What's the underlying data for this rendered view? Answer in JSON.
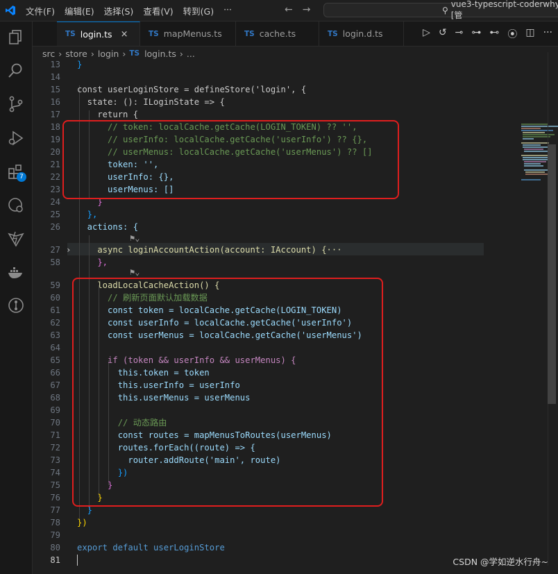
{
  "menu": [
    "文件(F)",
    "编辑(E)",
    "选择(S)",
    "查看(V)",
    "转到(G)",
    "···"
  ],
  "search_text": "vue3-typescript-coderwhy [管",
  "tabs": [
    {
      "icon": "TS",
      "label": "login.ts",
      "active": true,
      "close": "×"
    },
    {
      "icon": "TS",
      "label": "mapMenus.ts",
      "active": false
    },
    {
      "icon": "TS",
      "label": "cache.ts",
      "active": false
    },
    {
      "icon": "TS",
      "label": "login.d.ts",
      "active": false
    }
  ],
  "breadcrumb": {
    "parts": [
      "src",
      "store",
      "login"
    ],
    "file_icon": "TS",
    "file": "login.ts",
    "more": "..."
  },
  "badge_count": "7",
  "watermark": "CSDN @学如逆水行舟~",
  "code_lines": [
    {
      "n": "13",
      "text": "}"
    },
    {
      "n": "14",
      "text": ""
    },
    {
      "n": "15",
      "text": "const userLoginStore = defineStore('login', {"
    },
    {
      "n": "16",
      "text": "  state: (): ILoginState => {"
    },
    {
      "n": "17",
      "text": "    return {"
    },
    {
      "n": "18",
      "text": "      // token: localCache.getCache(LOGIN_TOKEN) ?? '',"
    },
    {
      "n": "19",
      "text": "      // userInfo: localCache.getCache('userInfo') ?? {},"
    },
    {
      "n": "20",
      "text": "      // userMenus: localCache.getCache('userMenus') ?? []"
    },
    {
      "n": "21",
      "text": "      token: '',"
    },
    {
      "n": "22",
      "text": "      userInfo: {},"
    },
    {
      "n": "23",
      "text": "      userMenus: []"
    },
    {
      "n": "24",
      "text": "    }"
    },
    {
      "n": "25",
      "text": "  },"
    },
    {
      "n": "26",
      "text": "  actions: {"
    },
    {
      "n": "27",
      "text": "    async loginAccountAction(account: IAccount) {···"
    },
    {
      "n": "58",
      "text": "    },"
    },
    {
      "n": "59",
      "text": "    loadLocalCacheAction() {"
    },
    {
      "n": "60",
      "text": "      // 刷新页面默认加载数据"
    },
    {
      "n": "61",
      "text": "      const token = localCache.getCache(LOGIN_TOKEN)"
    },
    {
      "n": "62",
      "text": "      const userInfo = localCache.getCache('userInfo')"
    },
    {
      "n": "63",
      "text": "      const userMenus = localCache.getCache('userMenus')"
    },
    {
      "n": "64",
      "text": ""
    },
    {
      "n": "65",
      "text": "      if (token && userInfo && userMenus) {"
    },
    {
      "n": "66",
      "text": "        this.token = token"
    },
    {
      "n": "67",
      "text": "        this.userInfo = userInfo"
    },
    {
      "n": "68",
      "text": "        this.userMenus = userMenus"
    },
    {
      "n": "69",
      "text": ""
    },
    {
      "n": "70",
      "text": "        // 动态路由"
    },
    {
      "n": "71",
      "text": "        const routes = mapMenusToRoutes(userMenus)"
    },
    {
      "n": "72",
      "text": "        routes.forEach((route) => {"
    },
    {
      "n": "73",
      "text": "          router.addRoute('main', route)"
    },
    {
      "n": "74",
      "text": "        })"
    },
    {
      "n": "75",
      "text": "      }"
    },
    {
      "n": "76",
      "text": "    }"
    },
    {
      "n": "77",
      "text": "  }"
    },
    {
      "n": "78",
      "text": "})"
    },
    {
      "n": "79",
      "text": ""
    },
    {
      "n": "80",
      "text": "export default userLoginStore"
    },
    {
      "n": "81",
      "text": ""
    }
  ]
}
